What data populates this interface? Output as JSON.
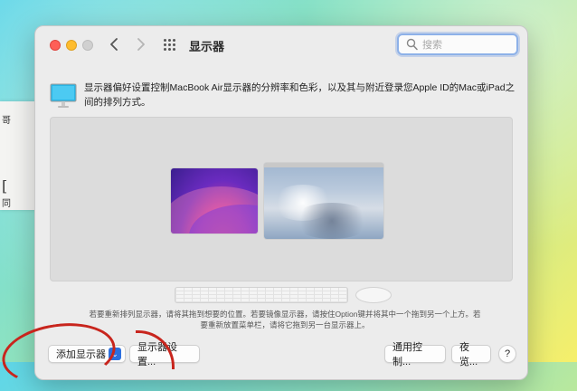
{
  "window": {
    "title": "显示器",
    "search_placeholder": "搜索"
  },
  "background": {
    "paper_text_1": "哥",
    "paper_text_2": "[",
    "paper_text_3": "同"
  },
  "description": {
    "text": "显示器偏好设置控制MacBook Air显示器的分辨率和色彩，以及其与附近登录您Apple ID的Mac或iPad之间的排列方式。"
  },
  "arrangement": {
    "hint": "若要重新排列显示器，请将其拖到想要的位置。若要镜像显示器，请按住Option键并将其中一个拖到另一个上方。若要重新放置菜单栏，请将它拖到另一台显示器上。"
  },
  "buttons": {
    "add_display": "添加显示器",
    "add_display_chevron": "⌄",
    "display_settings": "显示器设置...",
    "universal_control": "通用控制...",
    "night_shift": "夜览...",
    "help": "?"
  },
  "colors": {
    "accent": "#2c6fde",
    "annotation": "#c8251d"
  }
}
